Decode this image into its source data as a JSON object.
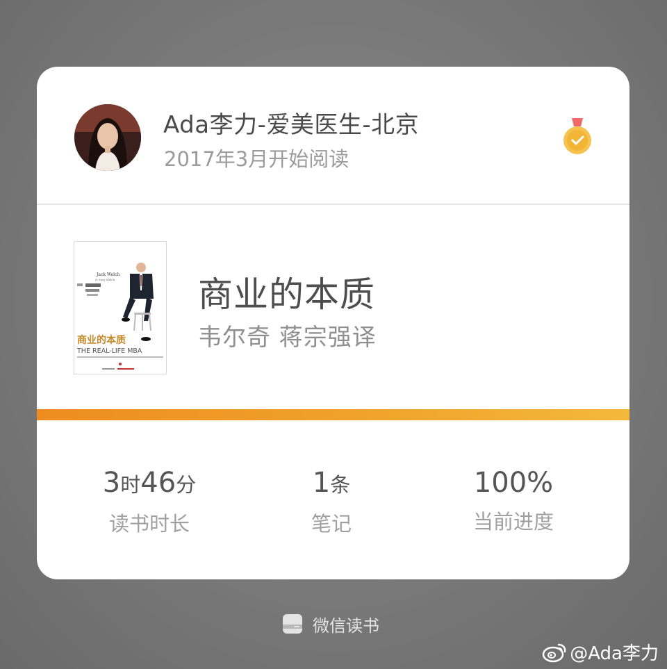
{
  "user": {
    "name": "Ada李力-爱美医生-北京",
    "since": "2017年3月开始阅读",
    "avatar_icon": "user-avatar",
    "badge_icon": "medal-icon"
  },
  "book": {
    "title": "商业的本质",
    "author": "韦尔奇 蒋宗强译",
    "cover": {
      "author_en": "Jack Welch",
      "coauthor_en": "& Suzy Welch",
      "title_cn": "商业的本质",
      "title_en": "THE REAL-LIFE MBA"
    },
    "progress_percent": 100
  },
  "stats": [
    {
      "value": "3",
      "unit1": "时",
      "value2": "46",
      "unit2": "分",
      "label": "读书时长"
    },
    {
      "value": "1",
      "unit1": "条",
      "value2": "",
      "unit2": "",
      "label": "笔记"
    },
    {
      "value": "100%",
      "unit1": "",
      "value2": "",
      "unit2": "",
      "label": "当前进度"
    }
  ],
  "footer": {
    "app_name": "微信读书",
    "app_icon": "weread-icon"
  },
  "watermark": {
    "text": "@Ada李力",
    "icon": "weibo-icon"
  },
  "colors": {
    "accent": "#f0a52b",
    "progress_start": "#ee8c1f",
    "progress_end": "#f4b83a",
    "medal_gold": "#f6c34e",
    "medal_ribbon": "#ef6a6a"
  }
}
